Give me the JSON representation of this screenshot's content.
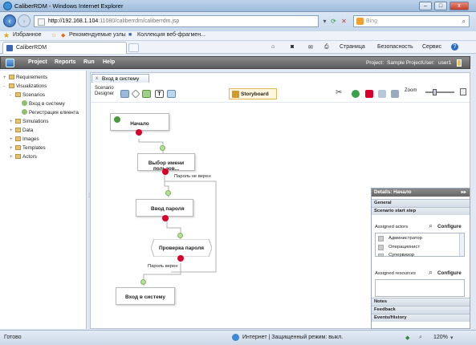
{
  "window": {
    "title": "CaliberRDM - Windows Internet Explorer"
  },
  "browser": {
    "url_host": "http://192.168.1.104",
    "url_rest": ":11080/caliberrdm/caliberrdm.jsp",
    "search_placeholder": "Bing",
    "favorites_label": "Избранное",
    "fav_items": [
      "Рекомендуемые узлы",
      "Коллекция веб-фрагмен..."
    ],
    "tab_title": "CaliberRDM",
    "cmd_page": "Страница",
    "cmd_security": "Безопасность",
    "cmd_service": "Сервис",
    "cmd_help": "?"
  },
  "app": {
    "menu": [
      "Project",
      "Reports",
      "Run",
      "Help"
    ],
    "project_label": "Project:",
    "project_value": "Sample Project",
    "user_label": "User:",
    "user_value": "user1"
  },
  "tree": [
    {
      "label": "Requirements",
      "level": 0,
      "expander": "+"
    },
    {
      "label": "Visualizations",
      "level": 0,
      "expander": "-"
    },
    {
      "label": "Scenarios",
      "level": 1,
      "expander": "-"
    },
    {
      "label": "Вход в систему",
      "level": 2,
      "expander": ""
    },
    {
      "label": "Регистрация клиента",
      "level": 2,
      "expander": ""
    },
    {
      "label": "Simulations",
      "level": 1,
      "expander": "+"
    },
    {
      "label": "Data",
      "level": 1,
      "expander": "+"
    },
    {
      "label": "Images",
      "level": 1,
      "expander": "+"
    },
    {
      "label": "Templates",
      "level": 1,
      "expander": "+"
    },
    {
      "label": "Actors",
      "level": 1,
      "expander": "+"
    }
  ],
  "editor": {
    "tab_label": "Вход в систему",
    "tab_close": "x",
    "designer_label_1": "Scenario",
    "designer_label_2": "Designer",
    "storyboard_label": "Storyboard",
    "zoom_label": "Zoom"
  },
  "diagram": {
    "nodes": [
      {
        "label": "Начало"
      },
      {
        "label": "Выбор имени пользов..."
      },
      {
        "label": "Ввод пароля"
      },
      {
        "label": "Проверка пароля"
      },
      {
        "label": "Вход в систему"
      }
    ],
    "edge_labels": {
      "wrong": "Пароль не верен",
      "right": "Пароль верен"
    }
  },
  "details": {
    "title": "Details: Начало",
    "collapse_icon": "▸▸",
    "section_general": "General",
    "section_start": "Scenario start step",
    "assigned_actors": "Assigned actors",
    "configure": "Configure",
    "actors": [
      "Администратор",
      "Операционист",
      "Супервизор"
    ],
    "assigned_resources": "Assigned resources",
    "section_notes": "Notes",
    "section_feedback": "Feedback",
    "section_events": "Events/History"
  },
  "status": {
    "left": "Готово",
    "zone": "Интернет | Защищенный режим: выкл.",
    "zoom": "120%"
  }
}
